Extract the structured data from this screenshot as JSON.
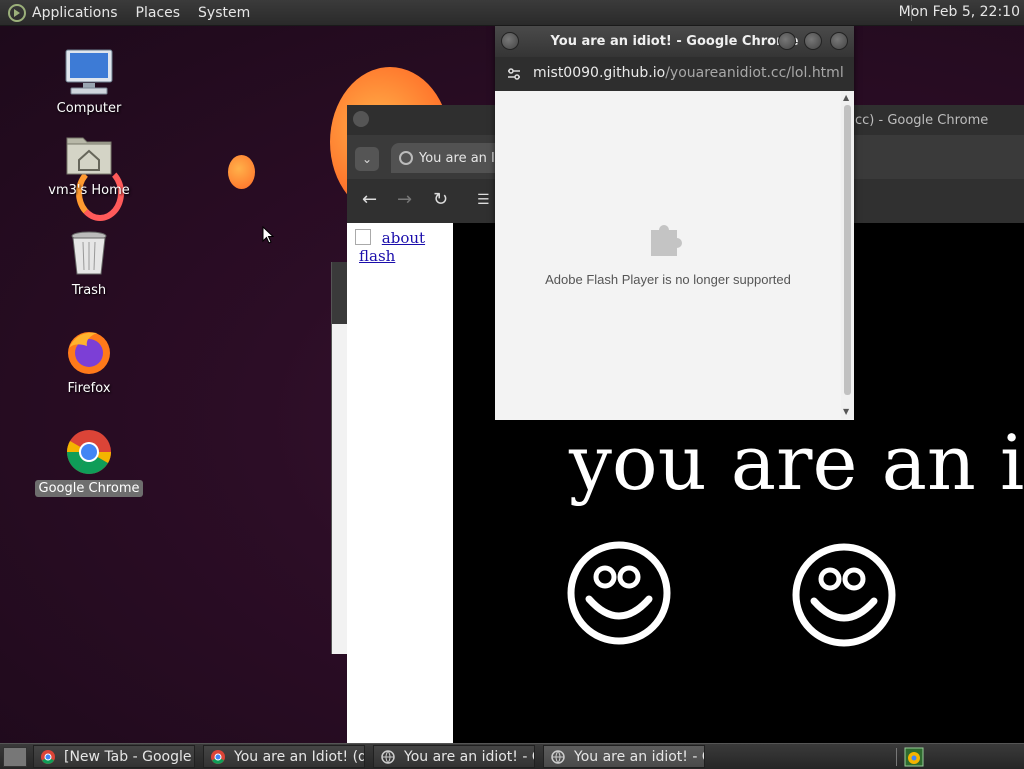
{
  "top_panel": {
    "menus": [
      "Applications",
      "Places",
      "System"
    ],
    "clock": "Mon Feb  5, 22:10"
  },
  "desktop_icons": [
    {
      "label": "Computer",
      "icon": "computer-icon"
    },
    {
      "label": "vm3's Home",
      "icon": "home-folder-icon"
    },
    {
      "label": "Trash",
      "icon": "trash-icon"
    },
    {
      "label": "Firefox",
      "icon": "firefox-icon"
    },
    {
      "label": "Google Chrome",
      "icon": "chrome-icon",
      "selected": true
    }
  ],
  "back_window": {
    "title": "cc) - Google Chrome",
    "tab_title": "You are an Id",
    "links": [
      "about",
      "flash"
    ],
    "big_text": "you are an idiot!"
  },
  "popup": {
    "title": "You are an idiot! - Google Chrome",
    "url_host": "mist0090.github.io",
    "url_path": "/youareanidiot.cc/lol.html",
    "message": "Adobe Flash Player is no longer supported"
  },
  "taskbar": {
    "tasks": [
      {
        "label": "[New Tab - Google ...",
        "active": false
      },
      {
        "label": "You are an Idiot! (do...",
        "active": false
      },
      {
        "label": "You are an idiot! - G...",
        "active": false
      },
      {
        "label": "You are an idiot! - G...",
        "active": true
      }
    ]
  }
}
